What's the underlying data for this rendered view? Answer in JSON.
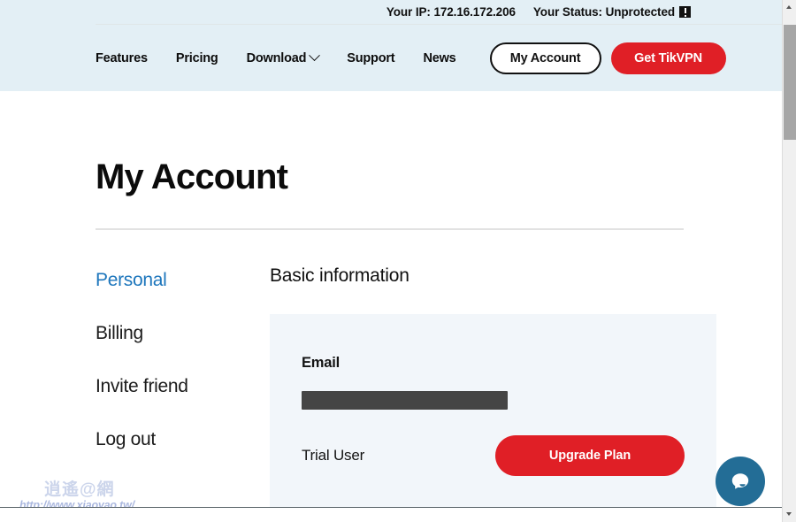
{
  "topbar": {
    "ip_text": "Your IP: 172.16.172.206",
    "status_text": "Your Status: Unprotected",
    "status_icon": "alert-icon"
  },
  "nav": {
    "links": [
      {
        "label": "Features"
      },
      {
        "label": "Pricing"
      },
      {
        "label": "Download",
        "icon": "chevron-down-icon"
      },
      {
        "label": "Support"
      },
      {
        "label": "News"
      }
    ],
    "my_account_label": "My Account",
    "get_vpn_label": "Get TikVPN"
  },
  "page": {
    "title": "My Account"
  },
  "sidebar": {
    "items": [
      {
        "label": "Personal",
        "active": true
      },
      {
        "label": "Billing",
        "active": false
      },
      {
        "label": "Invite friend",
        "active": false
      },
      {
        "label": "Log out",
        "active": false
      }
    ]
  },
  "panel": {
    "title": "Basic information",
    "email_label": "Email",
    "email_value": "",
    "plan_status": "Trial User",
    "upgrade_label": "Upgrade Plan"
  },
  "watermark": {
    "mark": "逍遙@網",
    "url": "http://www.xiaoyao.tw/"
  },
  "chat": {
    "icon": "chat-bubble-icon"
  },
  "colors": {
    "header_bg": "#e3eff5",
    "accent_red": "#e01f26",
    "link_blue": "#1d76bc",
    "card_bg": "#f2f6fa",
    "chat_blue": "#236d96",
    "redaction": "#454545"
  }
}
